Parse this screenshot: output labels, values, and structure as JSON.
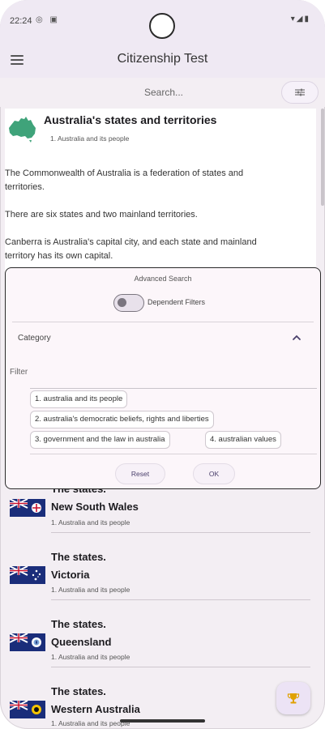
{
  "status_bar": {
    "time": "22:24",
    "left_icons": "◎ ▣",
    "right_icons": "▾◢▮"
  },
  "app_bar": {
    "title": "Citizenship Test"
  },
  "search": {
    "placeholder": "Search..."
  },
  "article": {
    "title": "Australia's states and territories",
    "category": "1. Australia and its people",
    "paragraphs": [
      "The Commonwealth of Australia is a federation of states and territories.",
      "There are six states and two mainland territories.",
      "Canberra is Australia's capital city, and each state and mainland territory has its own capital."
    ]
  },
  "advanced_search": {
    "title": "Advanced Search",
    "dependent_filters_label": "Dependent Filters",
    "dependent_filters_on": false,
    "category_label": "Category",
    "filter_label": "Filter",
    "chips": [
      "1. australia and its people",
      "2. australia's democratic beliefs, rights and liberties",
      "3. government and the law in australia",
      "4. australian values"
    ],
    "reset_label": "Reset",
    "ok_label": "OK"
  },
  "list": [
    {
      "kicker": "The states.",
      "title": "New South Wales",
      "category": "1. Australia and its people"
    },
    {
      "kicker": "The states.",
      "title": "Victoria",
      "category": "1. Australia and its people"
    },
    {
      "kicker": "The states.",
      "title": "Queensland",
      "category": "1. Australia and its people"
    },
    {
      "kicker": "The states.",
      "title": "Western Australia",
      "category": "1. Australia and its people"
    }
  ],
  "colors": {
    "accent": "#6750a4",
    "app_bar_bg": "#efe9f3",
    "map_green": "#3fa37a"
  }
}
